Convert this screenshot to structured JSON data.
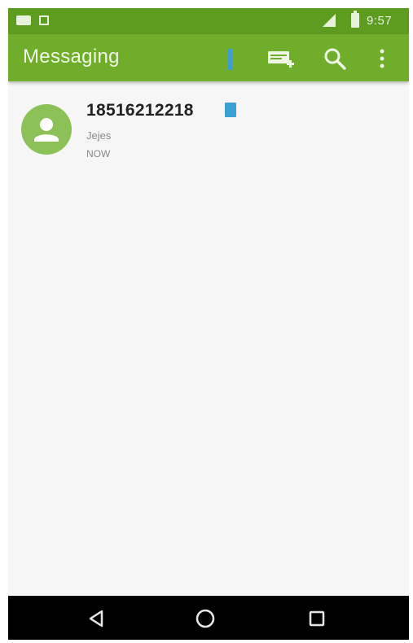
{
  "status_bar": {
    "time": "9:57"
  },
  "app_bar": {
    "title": "Messaging",
    "actions": [
      {
        "icon": "compose-icon"
      },
      {
        "icon": "search-icon"
      },
      {
        "icon": "more-vert-icon"
      }
    ]
  },
  "conversations": [
    {
      "name": "18516212218",
      "snippet": "Jejes",
      "time": "NOW",
      "avatar_icon": "person-icon",
      "unread": true
    }
  ],
  "nav_bar": {
    "buttons": [
      "back-icon",
      "home-icon",
      "recents-icon"
    ]
  },
  "colors": {
    "status_bar": "#5d9c1f",
    "app_bar": "#6fad2a",
    "avatar": "#8cc157",
    "accent": "#3c9fd4",
    "background": "#f6f6f6",
    "nav_bar": "#000000"
  }
}
